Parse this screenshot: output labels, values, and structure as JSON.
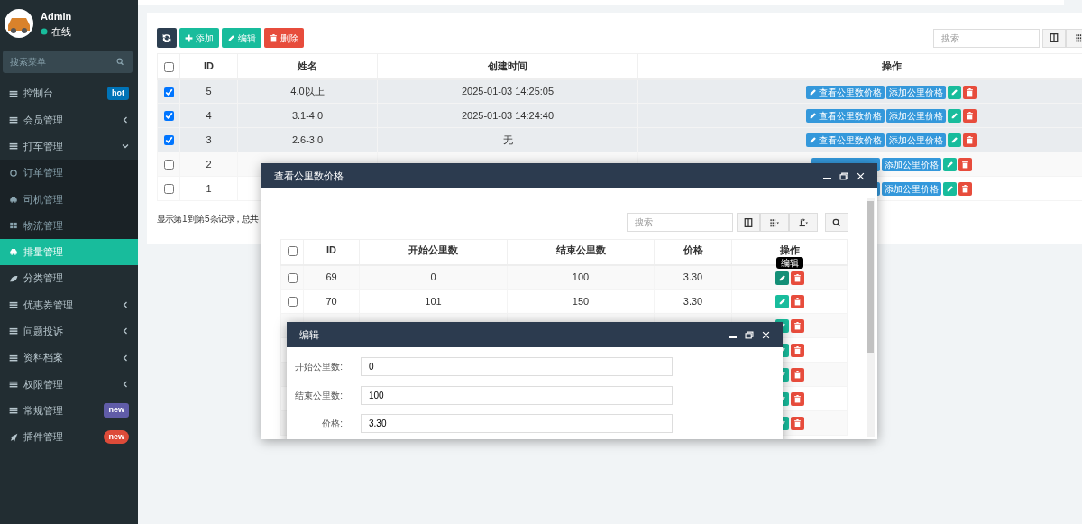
{
  "sidebar": {
    "user": {
      "name": "Admin",
      "status": "在线"
    },
    "search": {
      "placeholder": "搜索菜单"
    },
    "items": [
      {
        "label": "控制台",
        "kind": "list",
        "selected": false,
        "badge": {
          "text": "hot",
          "color": "#0073b7"
        }
      },
      {
        "label": "会员管理",
        "kind": "list",
        "selected": false,
        "expanded": false
      },
      {
        "label": "打车管理",
        "kind": "list",
        "selected": false,
        "expanded": true,
        "children": [
          {
            "label": "订单管理",
            "kind": "circle",
            "selected": false
          },
          {
            "label": "司机管理",
            "kind": "car",
            "selected": false
          },
          {
            "label": "物流管理",
            "kind": "grid",
            "selected": false
          }
        ]
      },
      {
        "label": "排量管理",
        "kind": "car",
        "selected": true
      },
      {
        "label": "分类管理",
        "kind": "leaf",
        "selected": false
      },
      {
        "label": "优惠券管理",
        "kind": "list",
        "selected": false,
        "expanded": false
      },
      {
        "label": "问题投诉",
        "kind": "list",
        "selected": false,
        "expanded": false
      },
      {
        "label": "资料档案",
        "kind": "list",
        "selected": false,
        "expanded": false
      },
      {
        "label": "权限管理",
        "kind": "list",
        "selected": false,
        "expanded": false
      },
      {
        "label": "常规管理",
        "kind": "list",
        "selected": false,
        "badge": {
          "text": "new",
          "color": "#605ca8"
        }
      },
      {
        "label": "插件管理",
        "kind": "rocket",
        "selected": false,
        "badge": {
          "text": "new",
          "color": "#dd4b39"
        }
      }
    ]
  },
  "toolbar": {
    "buttons": [
      {
        "kind": "refresh"
      },
      {
        "kind": "add",
        "label": "添加"
      },
      {
        "kind": "edit",
        "label": "编辑"
      },
      {
        "kind": "delete",
        "label": "删除"
      }
    ],
    "search": {
      "placeholder": "搜索"
    }
  },
  "table": {
    "all_checked": false,
    "columns": [
      "ID",
      "姓名",
      "创建时间",
      "操作"
    ],
    "rows": [
      {
        "checked": true,
        "id": "5",
        "name": "4.0以上",
        "created": "2025-01-03 14:25:05",
        "actions": [
          {
            "kind": "view",
            "label": "查看公里数价格"
          },
          {
            "kind": "add",
            "label": "添加公里价格"
          },
          {
            "kind": "edit"
          },
          {
            "kind": "delete"
          }
        ]
      },
      {
        "checked": true,
        "id": "4",
        "name": "3.1-4.0",
        "created": "2025-01-03 14:24:40",
        "actions": [
          {
            "kind": "view",
            "label": "查看公里数价格"
          },
          {
            "kind": "add",
            "label": "添加公里价格"
          },
          {
            "kind": "edit"
          },
          {
            "kind": "delete"
          }
        ]
      },
      {
        "checked": true,
        "id": "3",
        "name": "2.6-3.0",
        "created": "无",
        "actions": [
          {
            "kind": "view",
            "label": "查看公里数价格"
          },
          {
            "kind": "add",
            "label": "添加公里价格"
          },
          {
            "kind": "edit"
          },
          {
            "kind": "delete"
          }
        ]
      },
      {
        "checked": false,
        "id": "2",
        "actions": [
          {
            "kind": "view"
          },
          {
            "kind": "add",
            "label": "添加公里价格"
          },
          {
            "kind": "edit"
          },
          {
            "kind": "delete"
          }
        ]
      },
      {
        "checked": false,
        "id": "1",
        "actions": [
          {
            "kind": "view"
          },
          {
            "kind": "add",
            "label": "添加公里价格"
          },
          {
            "kind": "edit"
          },
          {
            "kind": "delete"
          }
        ]
      }
    ],
    "footer": "显示第 1 到第 5 条记录，总共"
  },
  "price_dialog": {
    "title": "查看公里数价格",
    "search": {
      "placeholder": "搜索"
    },
    "all_checked": false,
    "columns": [
      "ID",
      "开始公里数",
      "结束公里数",
      "价格",
      "操作"
    ],
    "rows": [
      {
        "kind": "data",
        "checked": false,
        "id": "69",
        "start": "0",
        "end": "100",
        "price": "3.30",
        "tooltip": "编辑"
      },
      {
        "kind": "data",
        "checked": false,
        "id": "70",
        "start": "101",
        "end": "150",
        "price": "3.30"
      },
      {
        "kind": "covered"
      },
      {
        "kind": "covered"
      },
      {
        "kind": "covered"
      },
      {
        "kind": "covered"
      },
      {
        "kind": "covered"
      }
    ]
  },
  "edit_dialog": {
    "title": "编辑",
    "fields": [
      {
        "label": "开始公里数:",
        "value": "0"
      },
      {
        "label": "结束公里数:",
        "value": "100"
      },
      {
        "label": "价格:",
        "value": "3.30"
      }
    ]
  }
}
